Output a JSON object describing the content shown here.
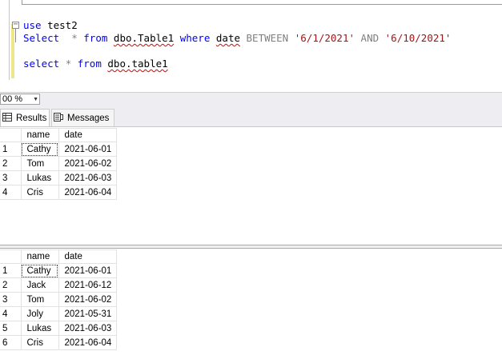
{
  "editor": {
    "line1": {
      "kw": "use",
      "db": "test2"
    },
    "line2": {
      "select_kw": "Select",
      "star": "*",
      "from_kw": "from",
      "table": "dbo.Table1",
      "where_kw": "where",
      "col": "date",
      "between_kw": "BETWEEN",
      "start": "'6/1/2021'",
      "and_kw": "AND",
      "end": "'6/10/2021'"
    },
    "line3": {
      "select_kw": "select",
      "star": "*",
      "from_kw": "from",
      "table": "dbo.table1"
    }
  },
  "zoom": {
    "value": "00 %"
  },
  "tabs": [
    {
      "label": "Results",
      "icon": "grid-icon",
      "active": true
    },
    {
      "label": "Messages",
      "icon": "messages-icon",
      "active": false
    }
  ],
  "result1": {
    "columns": [
      "name",
      "date"
    ],
    "rows": [
      {
        "n": "1",
        "name": "Cathy",
        "date": "2021-06-01"
      },
      {
        "n": "2",
        "name": "Tom",
        "date": "2021-06-02"
      },
      {
        "n": "3",
        "name": "Lukas",
        "date": "2021-06-03"
      },
      {
        "n": "4",
        "name": "Cris",
        "date": "2021-06-04"
      }
    ]
  },
  "result2": {
    "columns": [
      "name",
      "date"
    ],
    "rows": [
      {
        "n": "1",
        "name": "Cathy",
        "date": "2021-06-01"
      },
      {
        "n": "2",
        "name": "Jack",
        "date": "2021-06-12"
      },
      {
        "n": "3",
        "name": "Tom",
        "date": "2021-06-02"
      },
      {
        "n": "4",
        "name": "Joly",
        "date": "2021-05-31"
      },
      {
        "n": "5",
        "name": "Lukas",
        "date": "2021-06-03"
      },
      {
        "n": "6",
        "name": "Cris",
        "date": "2021-06-04"
      }
    ]
  },
  "colors": {
    "keyword": "#0000ff",
    "string": "#a31515",
    "operator": "#808080",
    "change_bar": "#f1e58a"
  }
}
